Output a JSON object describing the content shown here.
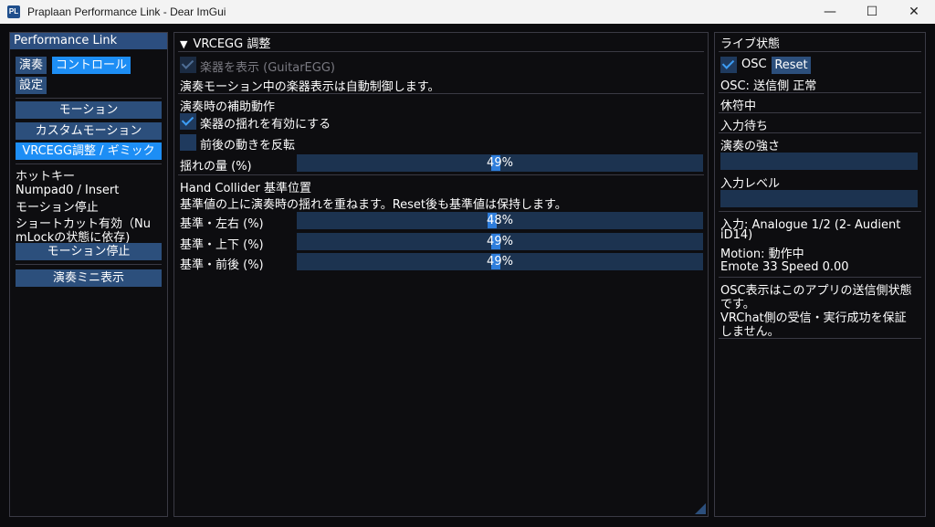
{
  "window": {
    "title": "Praplaan Performance Link - Dear ImGui",
    "icon_text": "PL",
    "minimize": "—",
    "maximize": "☐",
    "close": "✕"
  },
  "left": {
    "header": "Performance Link",
    "tab_play": "演奏",
    "tab_control": "コントロール",
    "tab_settings": "設定",
    "btn_motion": "モーション",
    "btn_custom_motion": "カスタムモーション",
    "btn_vrcegg": "VRCEGG調整 / ギミック",
    "hotkey_label": "ホットキー",
    "hotkey_keys": "Numpad0 / Insert",
    "hotkey_action": "モーション停止",
    "shortcut_line1": "ショートカット有効（Nu",
    "shortcut_line2": "mLockの状態に依存)",
    "btn_stop_motion": "モーション停止",
    "btn_mini_display": "演奏ミニ表示"
  },
  "center": {
    "section_title": "VRCEGG 調整",
    "show_instrument_label": "楽器を表示 (GuitarEGG)",
    "show_instrument_checked": true,
    "auto_control_note": "演奏モーション中の楽器表示は自動制御します。",
    "assist_header": "演奏時の補助動作",
    "enable_sway_label": "楽器の揺れを有効にする",
    "enable_sway_checked": true,
    "invert_label": "前後の動きを反転",
    "invert_checked": false,
    "sway_amount_label": "揺れの量 (%)",
    "sway_amount_value": "49%",
    "sway_amount_fraction": 0.49,
    "collider_header": "Hand Collider 基準位置",
    "collider_note": "基準値の上に演奏時の揺れを重ねます。Reset後も基準値は保持します。",
    "base_lr_label": "基準・左右 (%)",
    "base_lr_value": "48%",
    "base_lr_fraction": 0.48,
    "base_ud_label": "基準・上下 (%)",
    "base_ud_value": "49%",
    "base_ud_fraction": 0.49,
    "base_fb_label": "基準・前後 (%)",
    "base_fb_value": "49%",
    "base_fb_fraction": 0.49
  },
  "right": {
    "header": "ライブ状態",
    "osc_label": "OSC",
    "osc_checked": true,
    "reset_button": "Reset",
    "osc_status": "OSC: 送信側 正常",
    "state_idle": "休符中",
    "input_wait": "入力待ち",
    "strength_label": "演奏の強さ",
    "input_level_label": "入力レベル",
    "input_device_line1": "入力: Analogue 1/2 (2- Audient",
    "input_device_line2": "iD14)",
    "motion_status": "Motion: 動作中",
    "emote_status": "Emote 33  Speed 0.00",
    "note_line1": "OSC表示はこのアプリの送信側状態",
    "note_line2": "です。",
    "note_line3": "VRChat側の受信・実行成功を保証",
    "note_line4": "しません。"
  },
  "colors": {
    "button": "#2c4f7c",
    "active": "#1d8ef5",
    "header": "#2c4e7f",
    "frame": "#1c3350",
    "grab": "#2e7ddb",
    "check": "#3d9df5"
  }
}
